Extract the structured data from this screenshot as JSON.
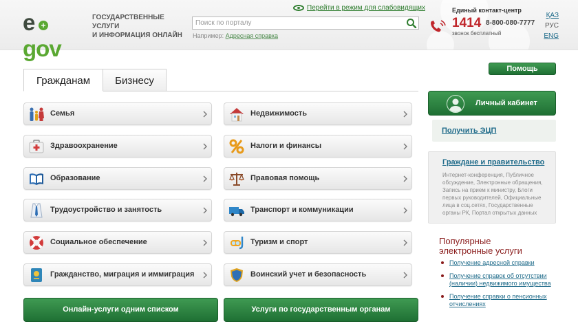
{
  "header": {
    "logo": {
      "left": "e",
      "right": "gov"
    },
    "caption": [
      "ГОСУДАРСТВЕННЫЕ УСЛУГИ",
      "И ИНФОРМАЦИЯ ОНЛАЙН"
    ],
    "accessibility_link": "Перейти в режим для слабовидящих",
    "search": {
      "placeholder": "Поиск по порталу",
      "hint_prefix": "Например:",
      "hint_link": "Адресная справка"
    },
    "contact": {
      "title": "Единый контакт-центр",
      "number": "1414",
      "alt_number": "8-800-080-7777",
      "free_note": "звонок бесплатный"
    },
    "languages": [
      {
        "code": "ҚАЗ",
        "active": false
      },
      {
        "code": "РУС",
        "active": true
      },
      {
        "code": "ENG",
        "active": false
      }
    ]
  },
  "tabs": [
    {
      "label": "Гражданам",
      "active": true
    },
    {
      "label": "Бизнесу",
      "active": false
    }
  ],
  "categories": {
    "left": [
      {
        "label": "Семья",
        "icon": "family-icon"
      },
      {
        "label": "Здравоохранение",
        "icon": "first-aid-icon"
      },
      {
        "label": "Образование",
        "icon": "book-icon"
      },
      {
        "label": "Трудоустройство и занятость",
        "icon": "shirt-tie-icon"
      },
      {
        "label": "Социальное обеспечение",
        "icon": "lifebuoy-icon"
      },
      {
        "label": "Гражданство, миграция и иммиграция",
        "icon": "passport-icon"
      }
    ],
    "right": [
      {
        "label": "Недвижимость",
        "icon": "house-icon"
      },
      {
        "label": "Налоги и финансы",
        "icon": "percent-icon"
      },
      {
        "label": "Правовая помощь",
        "icon": "scales-icon"
      },
      {
        "label": "Транспорт и коммуникации",
        "icon": "truck-icon"
      },
      {
        "label": "Туризм и спорт",
        "icon": "diving-mask-icon"
      },
      {
        "label": "Воинский учет и безопасность",
        "icon": "shield-icon"
      }
    ]
  },
  "bottom_buttons": {
    "online_list": "Онлайн-услуги одним списком",
    "by_agency": "Услуги по государственным органам"
  },
  "sidebar": {
    "help": "Помощь",
    "cabinet": "Личный кабинет",
    "eds_link": "Получить ЭЦП",
    "gov_title": "Граждане и правительство",
    "gov_desc": "Интернет-конференция, Публичное обсуждение, Электронные обращения, Запись на прием к министру, Блоги первых руководителей, Официальные лица в соц.сетях, Государственные органы РК, Портал открытых данных",
    "popular_title": [
      "Популярные",
      "электронные услуги"
    ],
    "popular": [
      "Получение адресной справки",
      "Получение справок об отсутствии (наличии) недвижимого имущества",
      "Получение справки о пенсионных отчислениях"
    ]
  },
  "colors": {
    "brand_green": "#2f8a44",
    "logo_green": "#5aa832",
    "contact_red": "#c0262b",
    "link_blue": "#1f6b8a",
    "popular_red": "#8a1c1c"
  }
}
